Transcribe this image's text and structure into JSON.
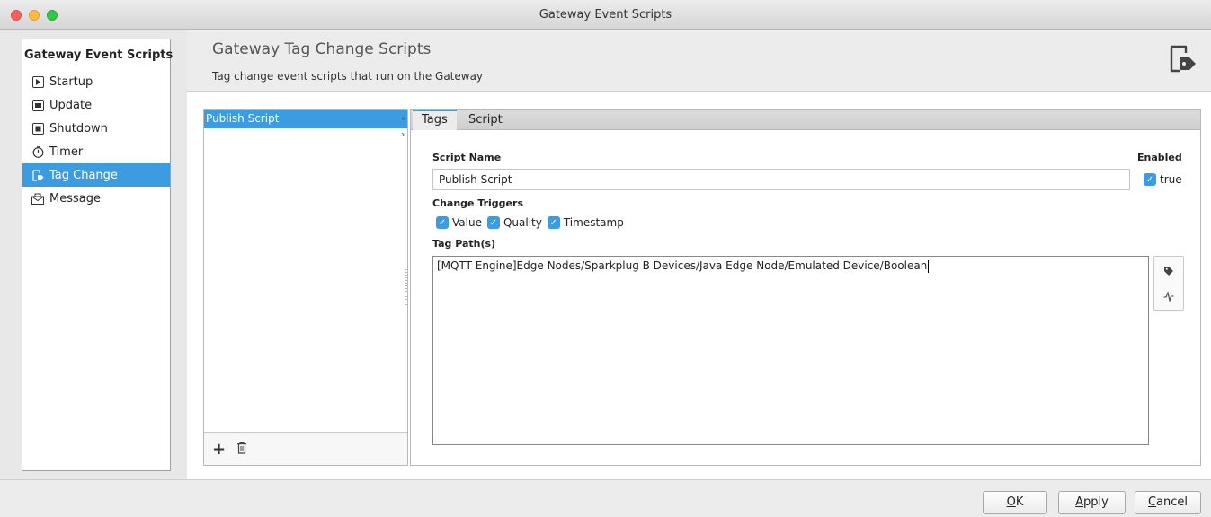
{
  "window": {
    "title": "Gateway Event Scripts"
  },
  "nav": {
    "heading": "Gateway Event Scripts",
    "items": [
      {
        "label": "Startup",
        "icon": "startup-icon"
      },
      {
        "label": "Update",
        "icon": "update-icon"
      },
      {
        "label": "Shutdown",
        "icon": "shutdown-icon"
      },
      {
        "label": "Timer",
        "icon": "timer-icon"
      },
      {
        "label": "Tag Change",
        "icon": "tag-change-icon",
        "selected": true
      },
      {
        "label": "Message",
        "icon": "message-icon"
      }
    ]
  },
  "header": {
    "title": "Gateway Tag Change Scripts",
    "subtitle": "Tag change event scripts that run on the Gateway"
  },
  "scripts": {
    "items": [
      {
        "label": "Publish Script",
        "selected": true
      }
    ]
  },
  "tabs": [
    {
      "label": "Tags",
      "active": true
    },
    {
      "label": "Script",
      "active": false
    }
  ],
  "form": {
    "script_name_label": "Script Name",
    "script_name_value": "Publish Script",
    "enabled_label": "Enabled",
    "enabled_value": "true",
    "change_triggers_label": "Change Triggers",
    "triggers": [
      {
        "label": "Value",
        "checked": true
      },
      {
        "label": "Quality",
        "checked": true
      },
      {
        "label": "Timestamp",
        "checked": true
      }
    ],
    "tag_paths_label": "Tag Path(s)",
    "tag_paths_value": "[MQTT Engine]Edge Nodes/Sparkplug B Devices/Java Edge Node/Emulated Device/Boolean"
  },
  "buttons": {
    "ok": {
      "mnemonic": "O",
      "rest": "K"
    },
    "apply": {
      "mnemonic": "A",
      "rest": "pply"
    },
    "cancel": {
      "mnemonic": "C",
      "rest": "ancel"
    }
  },
  "colors": {
    "accent": "#3d9be0"
  }
}
